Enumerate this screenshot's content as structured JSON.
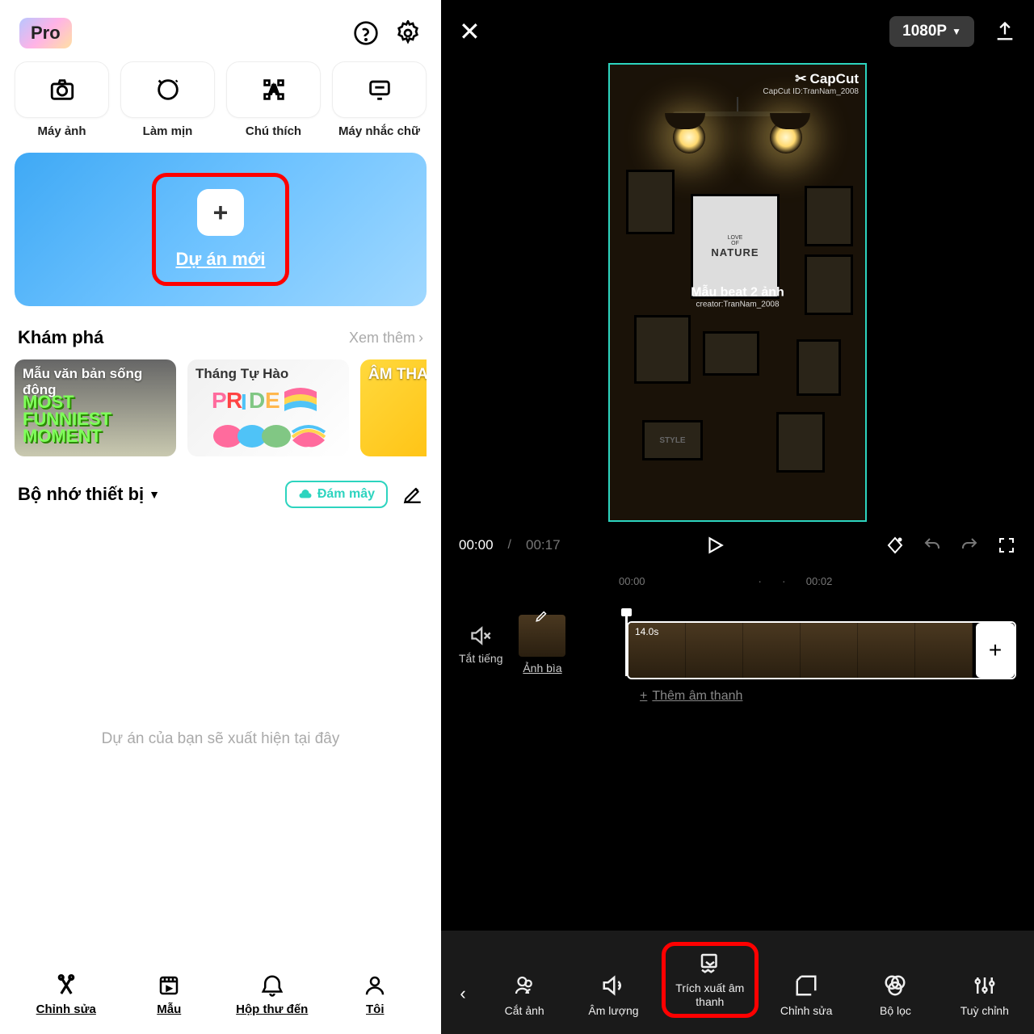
{
  "left": {
    "pro_badge": "Pro",
    "quick_actions": [
      {
        "label": "Máy ảnh"
      },
      {
        "label": "Làm mịn"
      },
      {
        "label": "Chú thích"
      },
      {
        "label": "Máy nhắc chữ"
      }
    ],
    "new_project_label": "Dự án mới",
    "discover_title": "Khám phá",
    "see_more": "Xem thêm",
    "discover_cards": [
      {
        "title": "Mẫu văn bản sống động",
        "graphic_top": "MOST",
        "graphic_bottom": "FUNNIEST MOMENT"
      },
      {
        "title": "Tháng Tự Hào"
      },
      {
        "title": "ÂM THANH"
      }
    ],
    "storage_title": "Bộ nhớ thiết bị",
    "cloud_label": "Đám mây",
    "empty_message": "Dự án của bạn sẽ xuất hiện tại đây",
    "nav": [
      {
        "label": "Chỉnh sửa"
      },
      {
        "label": "Mẫu"
      },
      {
        "label": "Hộp thư đến"
      },
      {
        "label": "Tôi"
      }
    ]
  },
  "right": {
    "resolution": "1080P",
    "watermark_brand": "CapCut",
    "watermark_id": "CapCut ID:TranNam_2008",
    "preview_title": "Mẫu beat 2 ảnh",
    "preview_creator": "creator:TranNam_2008",
    "nature_text": "NATURE",
    "nature_sub": "OF",
    "time_current": "00:00",
    "time_separator": "/",
    "time_duration": "00:17",
    "ticks": [
      "00:00",
      "00:02"
    ],
    "mute_label": "Tắt tiếng",
    "cover_label": "Ảnh bìa",
    "clip_duration": "14.0s",
    "add_audio": "Thêm âm thanh",
    "tools": [
      {
        "label": "Cắt ảnh"
      },
      {
        "label": "Âm lượng"
      },
      {
        "label": "Trích xuất âm thanh"
      },
      {
        "label": "Chỉnh sửa"
      },
      {
        "label": "Bộ lọc"
      },
      {
        "label": "Tuỳ chỉnh"
      }
    ]
  }
}
